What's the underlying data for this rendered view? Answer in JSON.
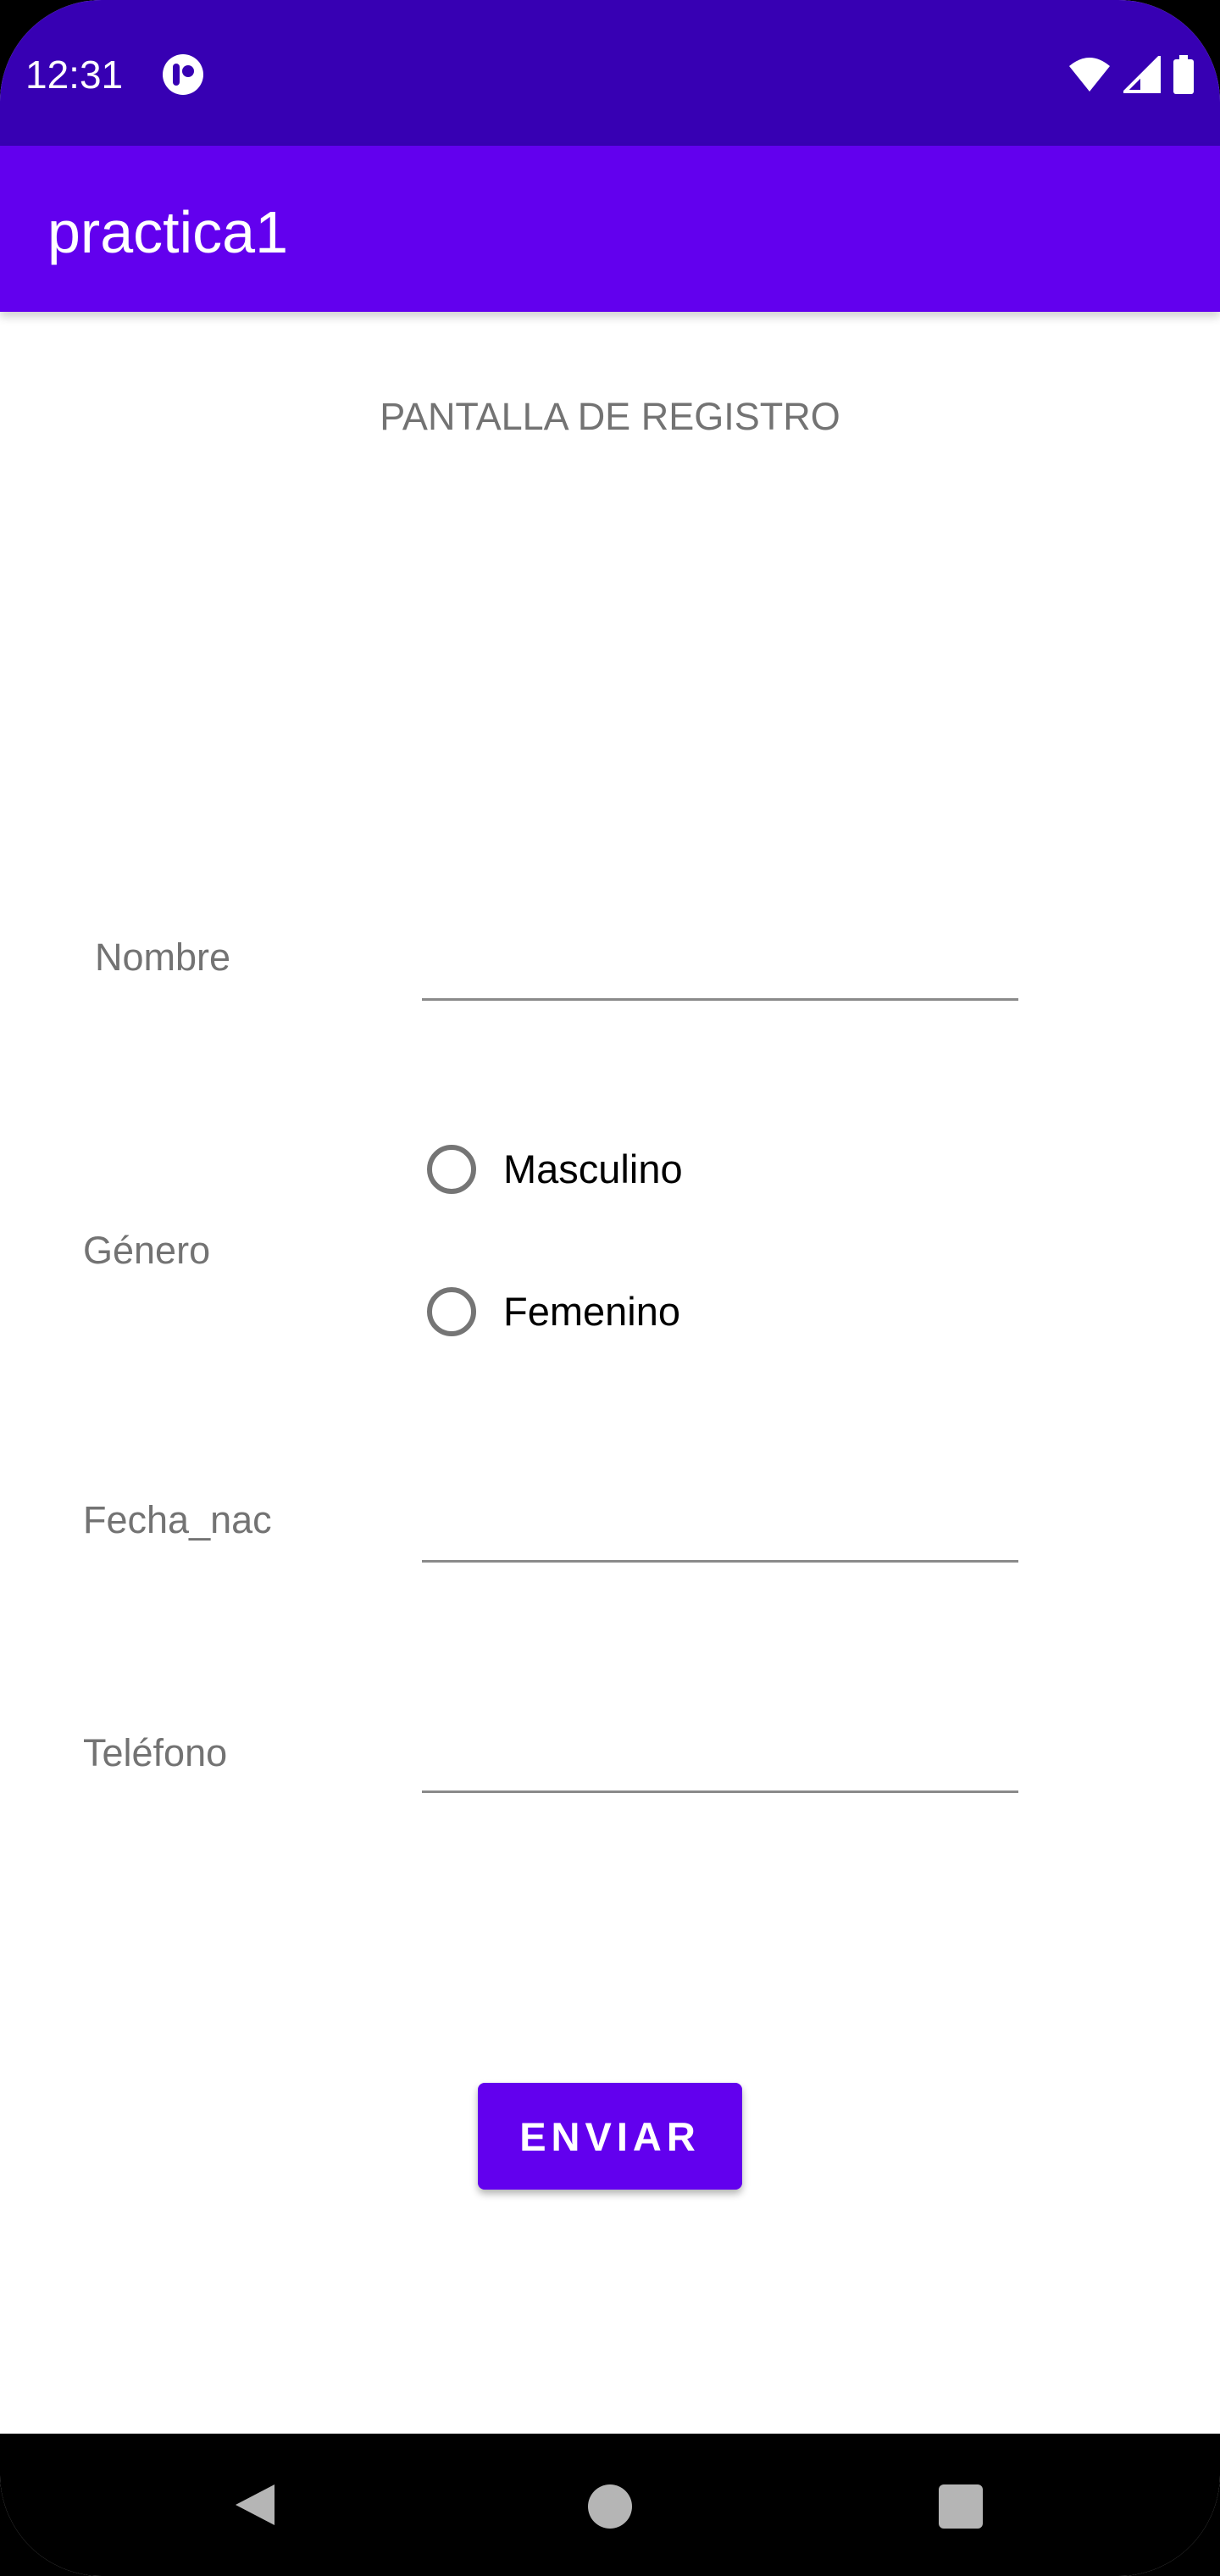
{
  "status_bar": {
    "time": "12:31",
    "app_icon": "notification-app-icon",
    "wifi_icon": "wifi-icon",
    "signal_icon": "cell-signal-icon",
    "battery_icon": "battery-icon"
  },
  "app_bar": {
    "title": "practica1"
  },
  "form": {
    "screen_title": "PANTALLA DE REGISTRO",
    "name_label": "Nombre",
    "name_value": "",
    "gender_label": "Género",
    "gender_options": [
      "Masculino",
      "Femenino"
    ],
    "birth_label": "Fecha_nac",
    "birth_value": "",
    "phone_label": "Teléfono",
    "phone_value": "",
    "submit_label": "ENVIAR"
  },
  "nav_bar": {
    "back_icon": "back-triangle-icon",
    "home_icon": "home-circle-icon",
    "recents_icon": "recents-square-icon"
  },
  "colors": {
    "status_bar": "#3700b3",
    "primary": "#6200ee",
    "label_gray": "#737373",
    "background": "#ffffff",
    "nav_bar": "#000000"
  }
}
